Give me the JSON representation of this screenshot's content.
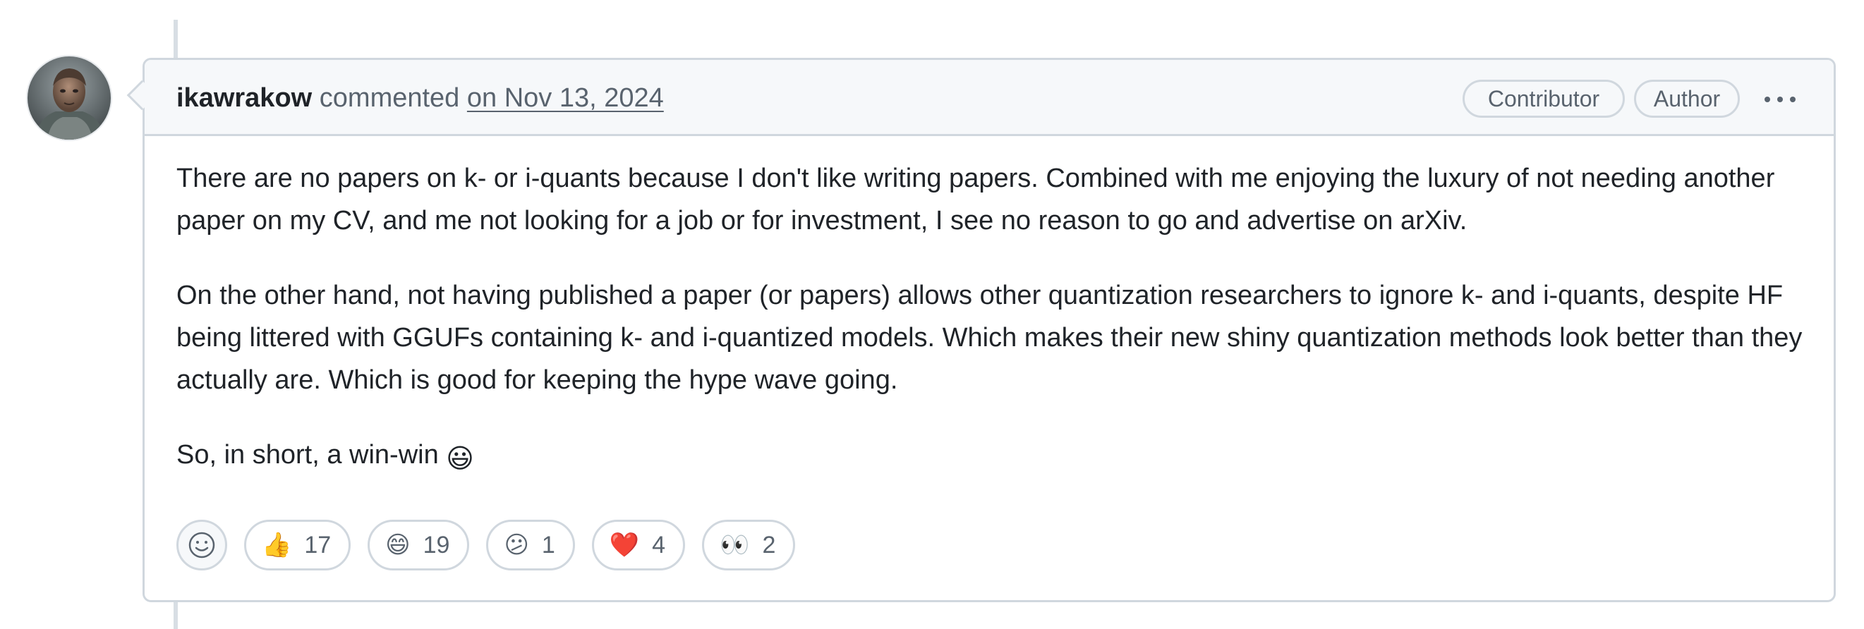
{
  "comment": {
    "author": "ikawrakow",
    "action": "commented",
    "timestamp": "on Nov 13, 2024",
    "labels": [
      "Contributor",
      "Author"
    ],
    "more_menu_icon": "kebab-horizontal-icon",
    "avatar_icon": "user-avatar",
    "paragraphs": [
      "There are no papers on k- or i-quants because I don't like writing papers. Combined with me enjoying the luxury of not needing another paper on my CV, and me not looking for a job or for investment, I see no reason to go and advertise on arXiv.",
      "On the other hand, not having published a paper (or papers) allows other quantization researchers to ignore k- and i-quants, despite HF being littered with GGUFs containing k- and i-quantized models. Which makes their new shiny quantization methods look better than they actually are. Which is good for keeping the hype wave going.",
      "So, in short, a win-win"
    ],
    "closing_emoji": "😃",
    "add_reaction_icon": "smiley-icon",
    "reactions": [
      {
        "emoji": "👍",
        "count": "17"
      },
      {
        "emoji": "😄",
        "count": "19"
      },
      {
        "emoji": "😕",
        "count": "1"
      },
      {
        "emoji": "❤️",
        "count": "4"
      },
      {
        "emoji": "👀",
        "count": "2"
      }
    ]
  },
  "colors": {
    "border": "#d0d7de",
    "header_bg": "#f6f8fa",
    "muted_text": "#59636e",
    "primary_text": "#1f2328",
    "timeline": "#d8dee4"
  }
}
